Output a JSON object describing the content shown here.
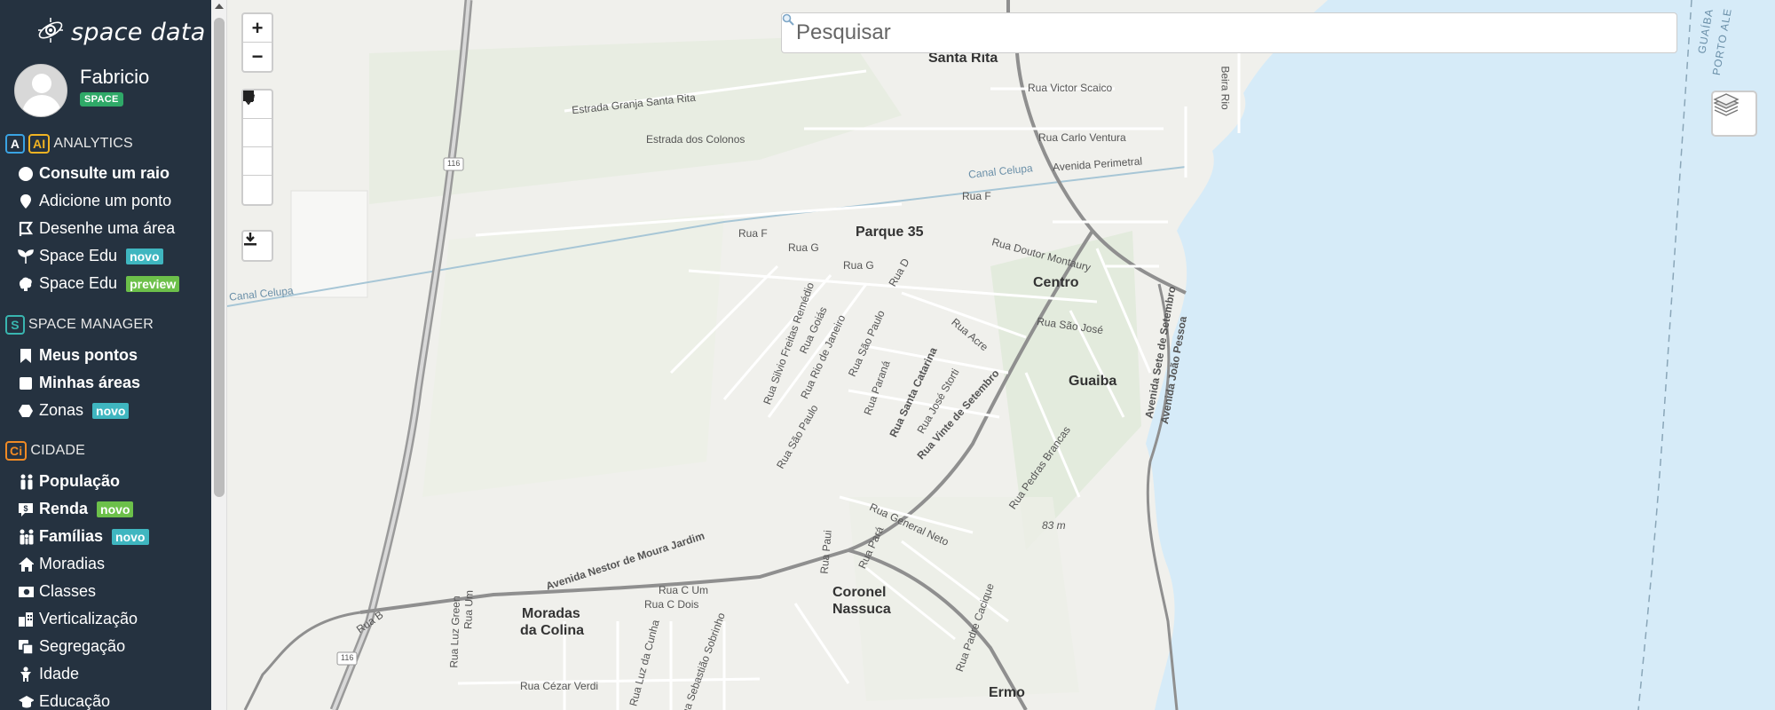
{
  "app": {
    "logo_text": "space data"
  },
  "user": {
    "name": "Fabricio",
    "badge": "SPACE"
  },
  "sections": {
    "analytics": {
      "badge_a": "A",
      "badge_ai": "AI",
      "label": "ANALYTICS"
    },
    "space_manager": {
      "badge": "S",
      "label": "SPACE MANAGER"
    },
    "cidade": {
      "badge": "Ci",
      "label": "CIDADE"
    }
  },
  "analytics_items": [
    {
      "label": "Consulte um raio",
      "icon": "circle-icon"
    },
    {
      "label": "Adicione um ponto",
      "icon": "pin-icon"
    },
    {
      "label": "Desenhe uma área",
      "icon": "draw-area-icon"
    },
    {
      "label": "Space Edu",
      "icon": "sprout-icon",
      "tag": "novo"
    },
    {
      "label": "Space Edu",
      "icon": "brain-icon",
      "tag": "preview"
    }
  ],
  "manager_items": [
    {
      "label": "Meus pontos",
      "icon": "bookmark-icon"
    },
    {
      "label": "Minhas áreas",
      "icon": "square-icon"
    },
    {
      "label": "Zonas",
      "icon": "hexagon-icon",
      "tag": "novo"
    }
  ],
  "cidade_items": [
    {
      "label": "População",
      "icon": "people-icon"
    },
    {
      "label": "Renda",
      "icon": "money-icon",
      "tag": "novo"
    },
    {
      "label": "Famílias",
      "icon": "family-icon",
      "tag": "novo"
    },
    {
      "label": "Moradias",
      "icon": "home-icon"
    },
    {
      "label": "Classes",
      "icon": "cash-icon"
    },
    {
      "label": "Verticalização",
      "icon": "building-icon"
    },
    {
      "label": "Segregação",
      "icon": "clone-icon"
    },
    {
      "label": "Idade",
      "icon": "child-icon"
    },
    {
      "label": "Educação",
      "icon": "education-icon"
    }
  ],
  "map": {
    "search_placeholder": "Pesquisar",
    "zoom_in": "+",
    "zoom_out": "−",
    "places": {
      "santa_rita": "Santa Rita",
      "parque35": "Parque 35",
      "centro": "Centro",
      "guaiba": "Guaiba",
      "coronel_l1": "Coronel",
      "coronel_l2": "Nassuca",
      "moradas_l1": "Moradas",
      "moradas_l2": "da Colina",
      "ermo": "Ermo"
    },
    "streets": {
      "granja": "Estrada Granja Santa Rita",
      "colonos": "Estrada dos Colonos",
      "victor": "Rua Victor Scaico",
      "carlo": "Rua Carlo Ventura",
      "beira": "Beira Rio",
      "canal1": "Canal Celupa",
      "perimetral": "Avenida Perimetral",
      "canal2": "Canal Celupa",
      "ruaf1": "Rua F",
      "ruaf2": "Rua F",
      "ruag1": "Rua G",
      "ruag2": "Rua G",
      "ruad": "Rua D",
      "montaury": "Rua Doutor Montaury",
      "saojose": "Rua São José",
      "acre": "Rua Acre",
      "saopaulo1": "Rua São Paulo",
      "saopaulo2": "Rua São Paulo",
      "saopaulo3": "Rua São Paulo",
      "riojaneiro": "Rua Rio de Janeiro",
      "goias": "Rua Goiás",
      "silvio": "Rua Silvio Freitas Remédio",
      "parana": "Rua Paraná",
      "catarina": "Rua Santa Catarina",
      "storti": "Rua José Storti",
      "vinte": "Rua Vinte de Setembro",
      "sete": "Avenida Sete de Setembro",
      "joao": "Avenida João Pessoa",
      "pedras": "Rua Pedras Brancas",
      "nestor": "Avenida Nestor de Moura Jardim",
      "general": "Rua General Neto",
      "paui": "Rua Paui",
      "para": "Rua Pará",
      "cum": "Rua C Um",
      "cdois": "Rua C Dois",
      "luzgreen": "Rua Luz Green",
      "rua_um": "Rua Um",
      "luzcunha": "Rua Luz da Cunha",
      "cezar": "Rua Cézar Verdi",
      "padre": "Rua Padre Cacique",
      "road116a": "116",
      "road116b": "116",
      "rua_b": "Rua B",
      "elevation": "83 m",
      "guaiba_water": "GUAÍBA",
      "porto_alegre": "PORTO ALE",
      "sobrinho": "Rua Sebastião Sobrinho"
    }
  }
}
